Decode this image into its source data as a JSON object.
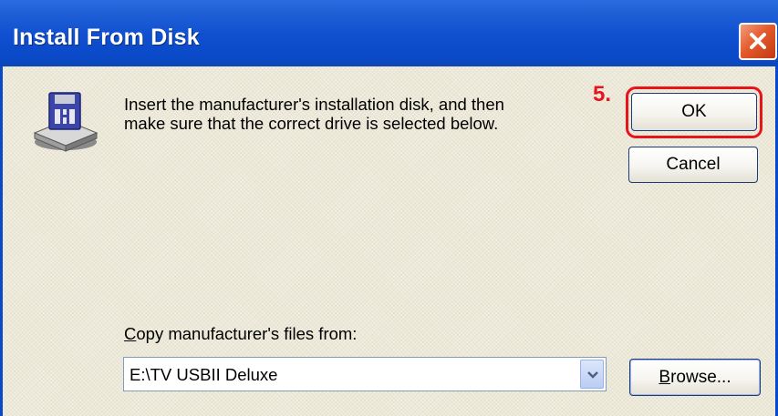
{
  "window": {
    "title": "Install From Disk",
    "close_icon": "close-icon"
  },
  "message": {
    "line1": "Insert the manufacturer's installation disk, and then",
    "line2": "make sure that the correct drive is selected below."
  },
  "annotation": {
    "step": "5.",
    "color": "#e8141c"
  },
  "buttons": {
    "ok": "OK",
    "cancel": "Cancel",
    "browse_access_key": "B",
    "browse_rest": "rowse..."
  },
  "copy_from": {
    "label_access_key": "C",
    "label_rest": "opy manufacturer's files from:",
    "value": "E:\\TV USBII Deluxe"
  },
  "colors": {
    "titlebar": "#0a4ac8",
    "close": "#e45a2c",
    "dialog_bg": "#ece9d8"
  }
}
